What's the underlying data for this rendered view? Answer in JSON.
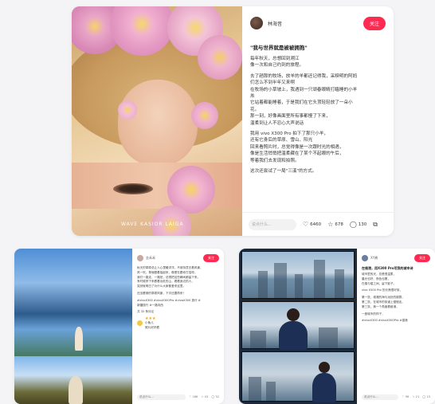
{
  "main_post": {
    "watermark": "WAVE KASIOR LAIGA",
    "author": "林海音",
    "follow": "关注",
    "title": "\"我与世界就是被被拥抱\"",
    "lines": [
      "每年秋天，总想回到溯江",
      "像一次和自己约到的旅程。",
      "",
      "去了趟那的牧场，放羊的羊都还记得我，采秧明的阿妈",
      "们怎么不到半年又来啊",
      "在牧场的小草坡上，我遇到一只顽春眼睛打瞌睡的小羊",
      "羔",
      "它站着都能睡着，于是我们在它头顶轻轻放了一朵小",
      "花。",
      "那一刻，好像画面里所有事都慢了下来，",
      "温柔到让人不忍心大声说话",
      "",
      "我用 vivo X300 Pro 拍下了那只小羊，",
      "还有它身后的草原、雪山、阳光",
      "回来看照片时，总觉得像是一次跟时光的相遇，",
      "像是生活悄悄把温柔藏在了某个不起眼的午后，",
      "等着我们去发现和拍照。",
      "",
      "这次还尝试了一局\"三溪\"的方式。"
    ],
    "comment_placeholder": "说点什么...",
    "likes": "6460",
    "collects": "678",
    "comments": "130"
  },
  "card_left": {
    "author": "金禾禾",
    "follow": "关注",
    "lines": [
      "秋天的草原总让人心里暖洋洋，不用特意去看风景，",
      "风一吹，草就跟着摇起来，像是在跟你打招呼。",
      "我们一路走，一路拍，总想把这些瞬间都留下来。",
      "有时候停下来看看远处的山，看看身边的人，",
      "突然就明白了为什么大家都爱来这里。",
      "",
      "还没看够的草原风景，下次还要再来！",
      "",
      "#vivoX300 #vivoX300Pro #vivoX300 旅行 #",
      "新疆旅行 #一路向西",
      "",
      "共 32 条评论"
    ],
    "comment_name": "小鱼儿",
    "comment_text": "照片好好看",
    "comment_placeholder": "说点什么...",
    "likes": "186",
    "collects": "43",
    "comments": "32"
  },
  "card_right": {
    "author": "XY酱",
    "follow": "关注",
    "title": "在维港，用X300 Pro写我的城市诗",
    "lines": [
      "城市里的光，总是很温柔，",
      "晨光也好、夜色也罢，",
      "在楼与楼之间，留下影子。",
      "",
      "vivo X300 Pro 的长焦很好用，",
      "",
      "第一张，维港的海与远处的楼群，",
      "第二张，在城市的街道上慢慢走。",
      "第三张，换一个角度看维港，",
      "",
      "一座城市的样子，",
      "",
      "#vivoX300 #vivoX300Pro #香港"
    ],
    "comment_placeholder": "说点什么...",
    "likes": "98",
    "collects": "21",
    "comments": "15"
  }
}
